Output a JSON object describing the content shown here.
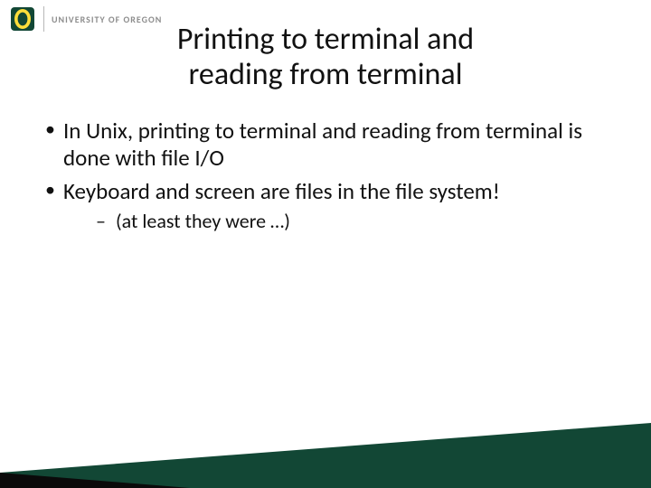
{
  "header": {
    "university": "UNIVERSITY OF OREGON",
    "logo_alt": "O logo"
  },
  "title": {
    "line1": "Printing to terminal and",
    "line2": "reading from terminal"
  },
  "bullets": [
    {
      "text": "In Unix, printing to terminal and reading from terminal is done with file I/O"
    },
    {
      "text": "Keyboard and screen are files in the file system!"
    }
  ],
  "sub_bullets": [
    {
      "text": "(at least they were …)"
    }
  ],
  "colors": {
    "brand_green": "#124735",
    "brand_yellow": "#fdde3a",
    "text": "#111111"
  }
}
